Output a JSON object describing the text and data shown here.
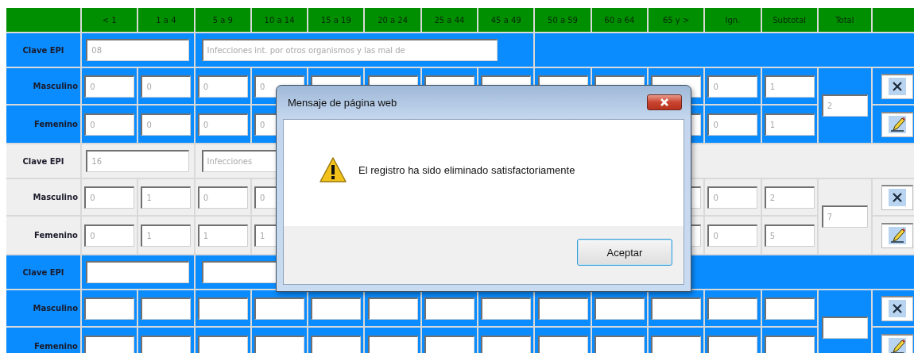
{
  "table": {
    "columns": [
      "< 1",
      "1 a 4",
      "5 a 9",
      "10 a 14",
      "15 a 19",
      "20 a 24",
      "25 a 44",
      "45 a 49",
      "50 a 59",
      "60 a 64",
      "65 y >",
      "Ign.",
      "Subtotal",
      "Total"
    ],
    "groups": [
      {
        "highlighted": true,
        "clave_label": "Clave EPI",
        "clave": "08",
        "description": "Infecciones int. por otros organismos y las mal de",
        "rows": [
          {
            "label": "Masculino",
            "values": {
              "lt_1": "0",
              "1_a_4": "0",
              "5_a_9": "0",
              "10_a_14": "0",
              "ign": "0",
              "subtotal": "1"
            }
          },
          {
            "label": "Femenino",
            "values": {
              "lt_1": "0",
              "1_a_4": "0",
              "5_a_9": "0",
              "10_a_14": "0",
              "ign": "0",
              "subtotal": "1"
            }
          }
        ],
        "total": "2"
      },
      {
        "highlighted": false,
        "clave_label": "Clave EPI",
        "clave": "16",
        "description": "Infecciones",
        "rows": [
          {
            "label": "Masculino",
            "values": {
              "lt_1": "0",
              "1_a_4": "1",
              "5_a_9": "0",
              "10_a_14": "0",
              "ign": "0",
              "subtotal": "2"
            }
          },
          {
            "label": "Femenino",
            "values": {
              "lt_1": "0",
              "1_a_4": "1",
              "5_a_9": "1",
              "10_a_14": "1",
              "ign": "0",
              "subtotal": "5"
            }
          }
        ],
        "total": "7"
      },
      {
        "highlighted": true,
        "clave_label": "Clave EPI",
        "rows": [
          {
            "label": "Masculino"
          },
          {
            "label": "Femenino"
          }
        ]
      }
    ]
  },
  "dialog": {
    "title": "Mensaje de página web",
    "message": "El registro ha sido eliminado satisfactoriamente",
    "button": "Aceptar"
  }
}
